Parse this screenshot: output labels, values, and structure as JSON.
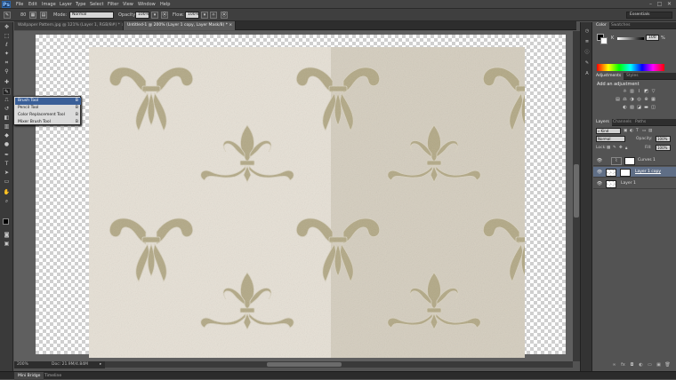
{
  "app": {
    "logo": "Ps"
  },
  "menubar": {
    "items": [
      "File",
      "Edit",
      "Image",
      "Layer",
      "Type",
      "Select",
      "Filter",
      "View",
      "Window",
      "Help"
    ],
    "window_buttons": [
      "–",
      "□",
      "✕"
    ]
  },
  "options": {
    "brush_size": "80",
    "mode_label": "Mode:",
    "mode_value": "Normal",
    "opacity_label": "Opacity:",
    "opacity_value": "100%",
    "flow_label": "Flow:",
    "flow_value": "100%",
    "workspace": "Essentials"
  },
  "tabs": [
    {
      "title": "Wallpaper Pattern.jpg @ 121% (Layer 1, RGB/8#) *",
      "close": "×"
    },
    {
      "title": "Untitled-1 @ 200% (Layer 1 copy, Layer Mask/8) *",
      "close": "×"
    }
  ],
  "flyout": {
    "items": [
      {
        "label": "Brush Tool",
        "key": "B"
      },
      {
        "label": "Pencil Tool",
        "key": "B"
      },
      {
        "label": "Color Replacement Tool",
        "key": "B"
      },
      {
        "label": "Mixer Brush Tool",
        "key": "B"
      }
    ]
  },
  "status": {
    "zoom": "200%",
    "doc": "Doc: 21.9M/4.84M"
  },
  "bottom_tabs": [
    "Mini Bridge",
    "Timeline"
  ],
  "panels": {
    "color_tabs": [
      "Color",
      "Swatches"
    ],
    "color_k": "K",
    "color_value": "100",
    "color_unit": "%",
    "adj_tabs": [
      "Adjustments",
      "Styles"
    ],
    "adj_title": "Add an adjustment",
    "layers_tabs": [
      "Layers",
      "Channels",
      "Paths"
    ],
    "kind": "Kind",
    "blend": "Normal",
    "opacity_label": "Opacity:",
    "opacity_value": "100%",
    "lock_label": "Lock:",
    "fill_label": "Fill:",
    "fill_value": "100%",
    "layers": [
      {
        "name": "Curves 1"
      },
      {
        "name": "Layer 1 copy"
      },
      {
        "name": "Layer 1"
      }
    ]
  },
  "colors": {
    "accent": "#3a5f98",
    "pattern_bg": "#e6e0d5",
    "ornament": "#b2a885"
  }
}
